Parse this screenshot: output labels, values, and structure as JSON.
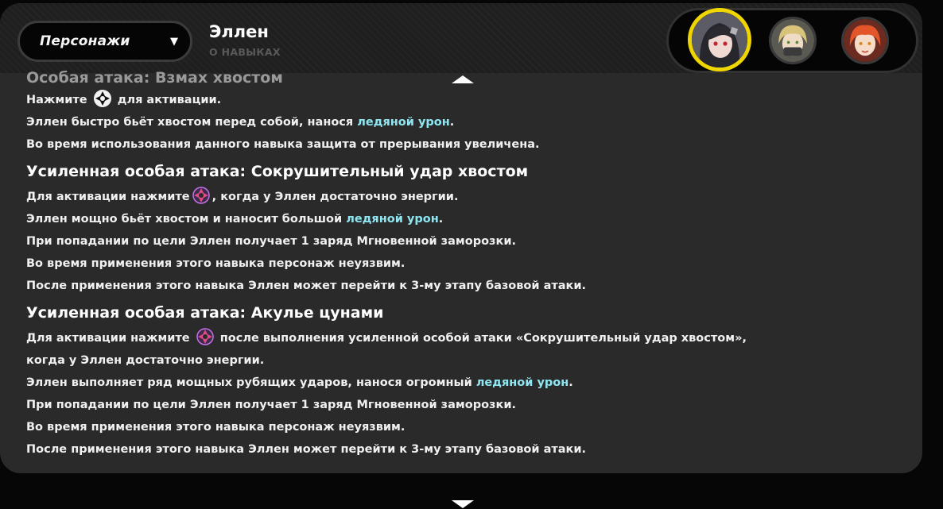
{
  "header": {
    "dropdown_label": "Персонажи",
    "character_name": "Эллен",
    "subtitle": "О НАВЫКАХ"
  },
  "avatars": [
    {
      "name": "ellen-avatar",
      "selected": true,
      "hair": "#2a2a2e",
      "skin": "#f1d9d3",
      "eye": "#c2262f"
    },
    {
      "name": "agent-2-avatar",
      "selected": false,
      "hair": "#d9c27a",
      "skin": "#f0dcc4",
      "eye": "#5a8a3a"
    },
    {
      "name": "agent-3-avatar",
      "selected": false,
      "hair": "#e2562a",
      "skin": "#f6dcc8",
      "eye": "#d98a1a"
    }
  ],
  "colors": {
    "accent": "#f0d600",
    "ice_damage": "#8fe6f1",
    "panel": "#2a2a2a"
  },
  "sections": [
    {
      "title": "Особая атака: Взмах хвостом",
      "faded": true,
      "line1_a": "Нажмите",
      "line1_b": "для активации.",
      "line2_a": "Эллен быстро бьёт хвостом перед собой, нанося",
      "line2_ice": "ледяной урон",
      "line2_b": ".",
      "line3": "Во время использования данного навыка защита от прерывания увеличена."
    },
    {
      "title": "Усиленная особая атака: Сокрушительный удар хвостом",
      "line1_a": "Для активации нажмите",
      "line1_b": ", когда у Эллен достаточно энергии.",
      "line2_a": "Эллен мощно бьёт хвостом и наносит большой",
      "line2_ice": "ледяной урон",
      "line2_b": ".",
      "line3": "При попадании по цели Эллен получает 1 заряд Мгновенной заморозки.",
      "line4": "Во время применения этого навыка персонаж неуязвим.",
      "line5": "После применения этого навыка Эллен может перейти к 3-му этапу базовой атаки."
    },
    {
      "title": "Усиленная особая атака: Акулье цунами",
      "line1_a": "Для активации нажмите",
      "line1_b": "после выполнения усиленной особой атаки «Сокрушительный удар хвостом»,",
      "line2": "когда у Эллен достаточно энергии.",
      "line3_a": "Эллен выполняет ряд мощных рубящих ударов, нанося огромный",
      "line3_ice": "ледяной урон",
      "line3_b": ".",
      "line4": "При попадании по цели Эллен получает 1 заряд Мгновенной заморозки.",
      "line5": "Во время применения этого навыка персонаж неуязвим.",
      "line6": "После применения этого навыка Эллен может перейти к 3-му этапу базовой атаки."
    }
  ]
}
